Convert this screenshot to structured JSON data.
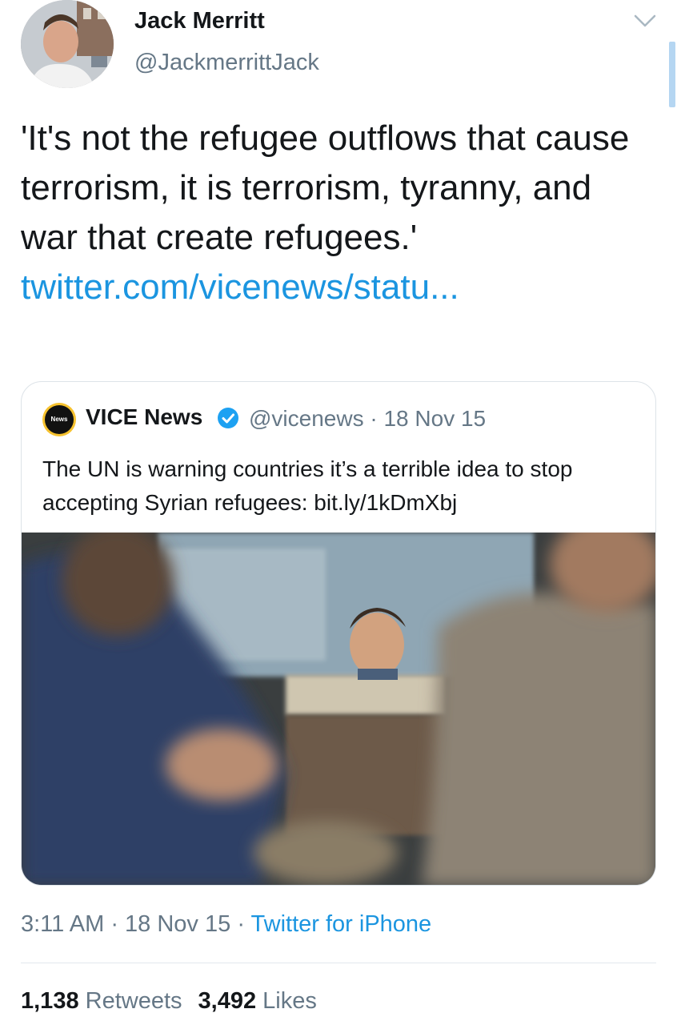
{
  "author": {
    "name": "Jack Merritt",
    "handle": "@JackmerrittJack"
  },
  "tweet": {
    "text": "'It's not the refugee outflows that cause terrorism, it is terrorism, tyranny, and war that create refugees.'",
    "link": "twitter.com/vicenews/statu..."
  },
  "quoted": {
    "name": "VICE News",
    "logo_text": "News",
    "handle": "@vicenews",
    "separator": "·",
    "date": "18 Nov 15",
    "text": "The UN is warning countries it’s a terrible idea to stop accepting Syrian refugees: bit.ly/1kDmXbj"
  },
  "meta": {
    "time": "3:11 AM",
    "separator": "·",
    "date": "18 Nov 15",
    "source": "Twitter for iPhone"
  },
  "stats": {
    "retweets_count": "1,138",
    "retweets_label": "Retweets",
    "likes_count": "3,492",
    "likes_label": "Likes"
  },
  "colors": {
    "link": "#1b95e0",
    "secondary_text": "#657786",
    "verified": "#1da1f2",
    "vice_logo_ring": "#f6c22f"
  },
  "icons": {
    "caret": "chevron-down-icon",
    "verified": "verified-badge-icon"
  }
}
